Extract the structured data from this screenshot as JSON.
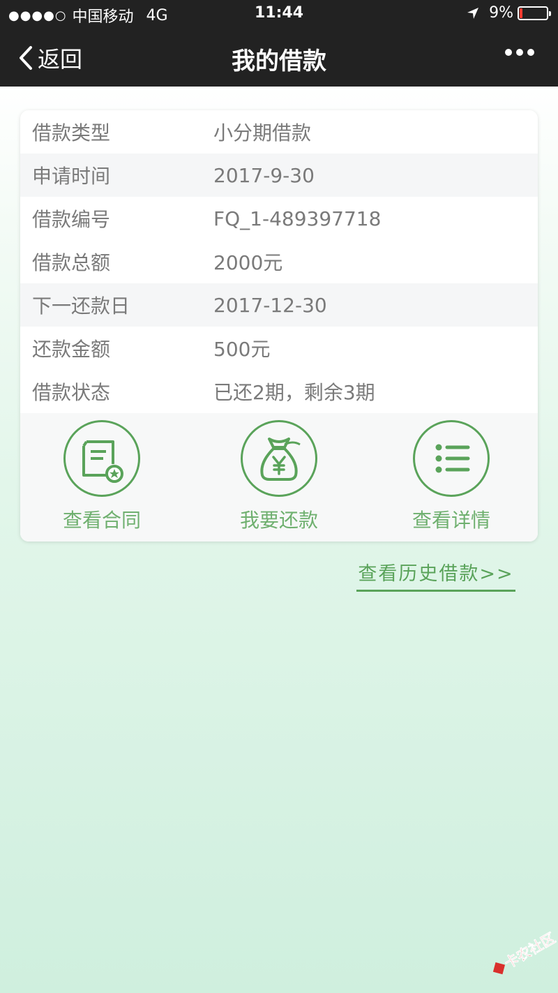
{
  "status_bar": {
    "carrier": "中国移动",
    "network": "4G",
    "time": "11:44",
    "battery": "9%",
    "signal_dots": "●●●●○"
  },
  "nav": {
    "back_label": "返回",
    "title": "我的借款"
  },
  "loan_details": [
    {
      "label": "借款类型",
      "value": "小分期借款"
    },
    {
      "label": "申请时间",
      "value": "2017-9-30"
    },
    {
      "label": "借款编号",
      "value": "FQ_1-489397718"
    },
    {
      "label": "借款总额",
      "value": "2000元"
    },
    {
      "label": "下一还款日",
      "value": "2017-12-30"
    },
    {
      "label": "还款金额",
      "value": "500元"
    },
    {
      "label": "借款状态",
      "value": "已还2期，剩余3期"
    }
  ],
  "actions": [
    {
      "label": "查看合同",
      "icon": "contract-icon"
    },
    {
      "label": "我要还款",
      "icon": "money-bag-icon"
    },
    {
      "label": "查看详情",
      "icon": "list-icon"
    }
  ],
  "history_link": "查看历史借款>>",
  "watermark": {
    "text": "卡农社区"
  },
  "colors": {
    "accent": "#5aa35a",
    "header_bg": "#222222",
    "battery_low": "#ff3b30"
  }
}
